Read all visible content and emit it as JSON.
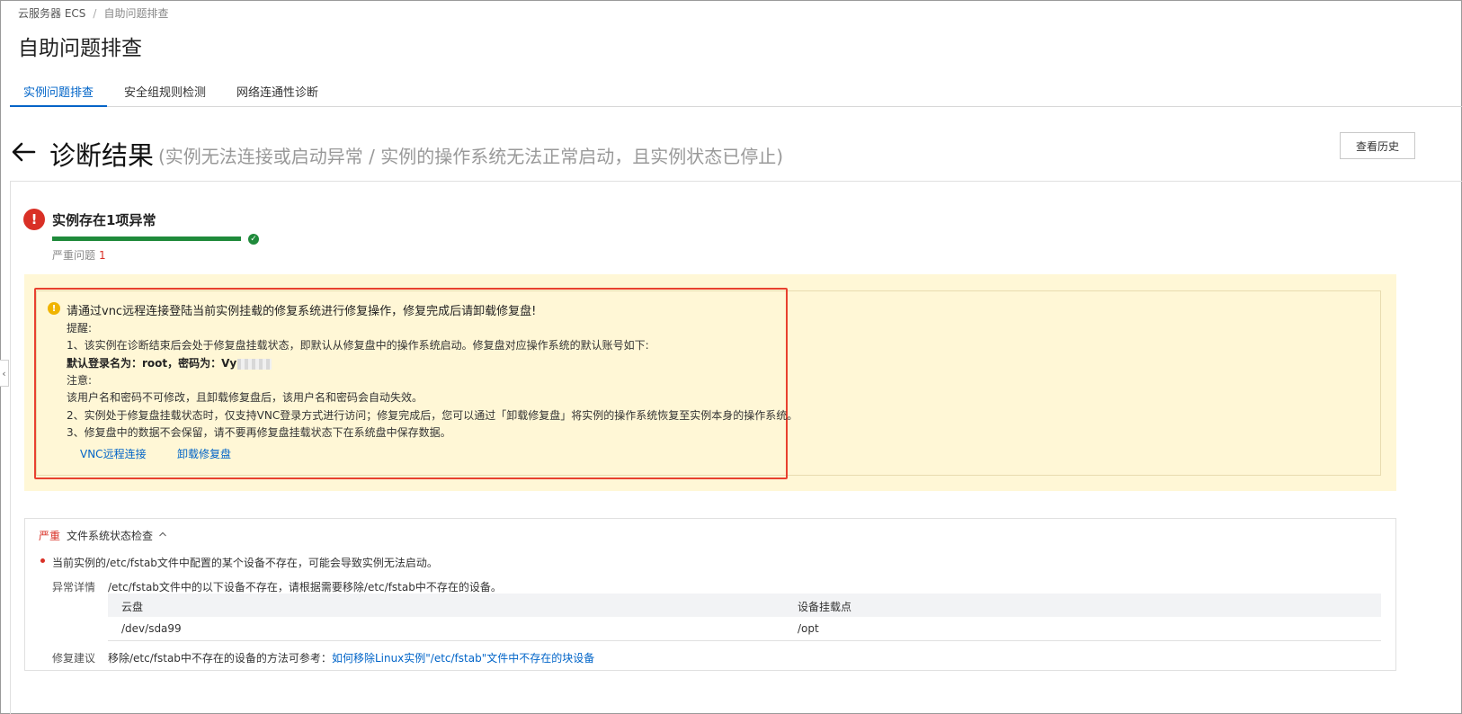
{
  "breadcrumb": {
    "root": "云服务器 ECS",
    "separator": "/",
    "current": "自助问题排查"
  },
  "page_title": "自助问题排查",
  "tabs": [
    {
      "label": "实例问题排查",
      "active": true
    },
    {
      "label": "安全组规则检测",
      "active": false
    },
    {
      "label": "网络连通性诊断",
      "active": false
    }
  ],
  "result": {
    "title": "诊断结果",
    "subtitle": "(实例无法连接或启动异常 / 实例的操作系统无法正常启动，且实例状态已停止)",
    "history_button": "查看历史"
  },
  "summary": {
    "title": "实例存在1项异常",
    "progress_fraction": 1.0,
    "severe_label": "严重问题",
    "severe_count": "1"
  },
  "notice": {
    "headline": "请通过vnc远程连接登陆当前实例挂载的修复系统进行修复操作，修复完成后请卸载修复盘!",
    "reminder_label": "提醒:",
    "line1": "1、该实例在诊断结束后会处于修复盘挂载状态，即默认从修复盘中的操作系统启动。修复盘对应操作系统的默认账号如下:",
    "credentials": "默认登录名为：root，密码为：Vy",
    "note_label": "注意:",
    "note_text": "该用户名和密码不可修改，且卸载修复盘后，该用户名和密码会自动失效。",
    "line2": "2、实例处于修复盘挂载状态时，仅支持VNC登录方式进行访问；修复完成后，您可以通过「卸载修复盘」将实例的操作系统恢复至实例本身的操作系统。",
    "line3": "3、修复盘中的数据不会保留，请不要再修复盘挂载状态下在系统盘中保存数据。",
    "vnc_link": "VNC远程连接",
    "unmount_link": "卸载修复盘"
  },
  "check": {
    "severity": "严重",
    "title": "文件系统状态检查",
    "issue": "当前实例的/etc/fstab文件中配置的某个设备不存在，可能会导致实例无法启动。",
    "detail_label": "异常详情",
    "detail_text": "/etc/fstab文件中的以下设备不存在，请根据需要移除/etc/fstab中不存在的设备。",
    "table": {
      "columns": [
        "云盘",
        "设备挂载点"
      ],
      "rows": [
        [
          "/dev/sda99",
          "/opt"
        ]
      ]
    },
    "advice_label": "修复建议",
    "advice_text": "移除/etc/fstab中不存在的设备的方法可参考：",
    "advice_link": "如何移除Linux实例\"/etc/fstab\"文件中不存在的块设备"
  },
  "colors": {
    "accent": "#0064c8",
    "error": "#d93026",
    "success": "#1f8a3b",
    "warning": "#f0b400",
    "notice_bg": "#fff7d6",
    "highlight_border": "#e8412f"
  },
  "icons": {
    "back": "arrow-left-icon",
    "error": "exclamation-circle-icon",
    "ok": "check-circle-icon",
    "warn": "warning-circle-icon",
    "collapse": "chevron-up-icon",
    "side": "chevron-left-icon"
  }
}
